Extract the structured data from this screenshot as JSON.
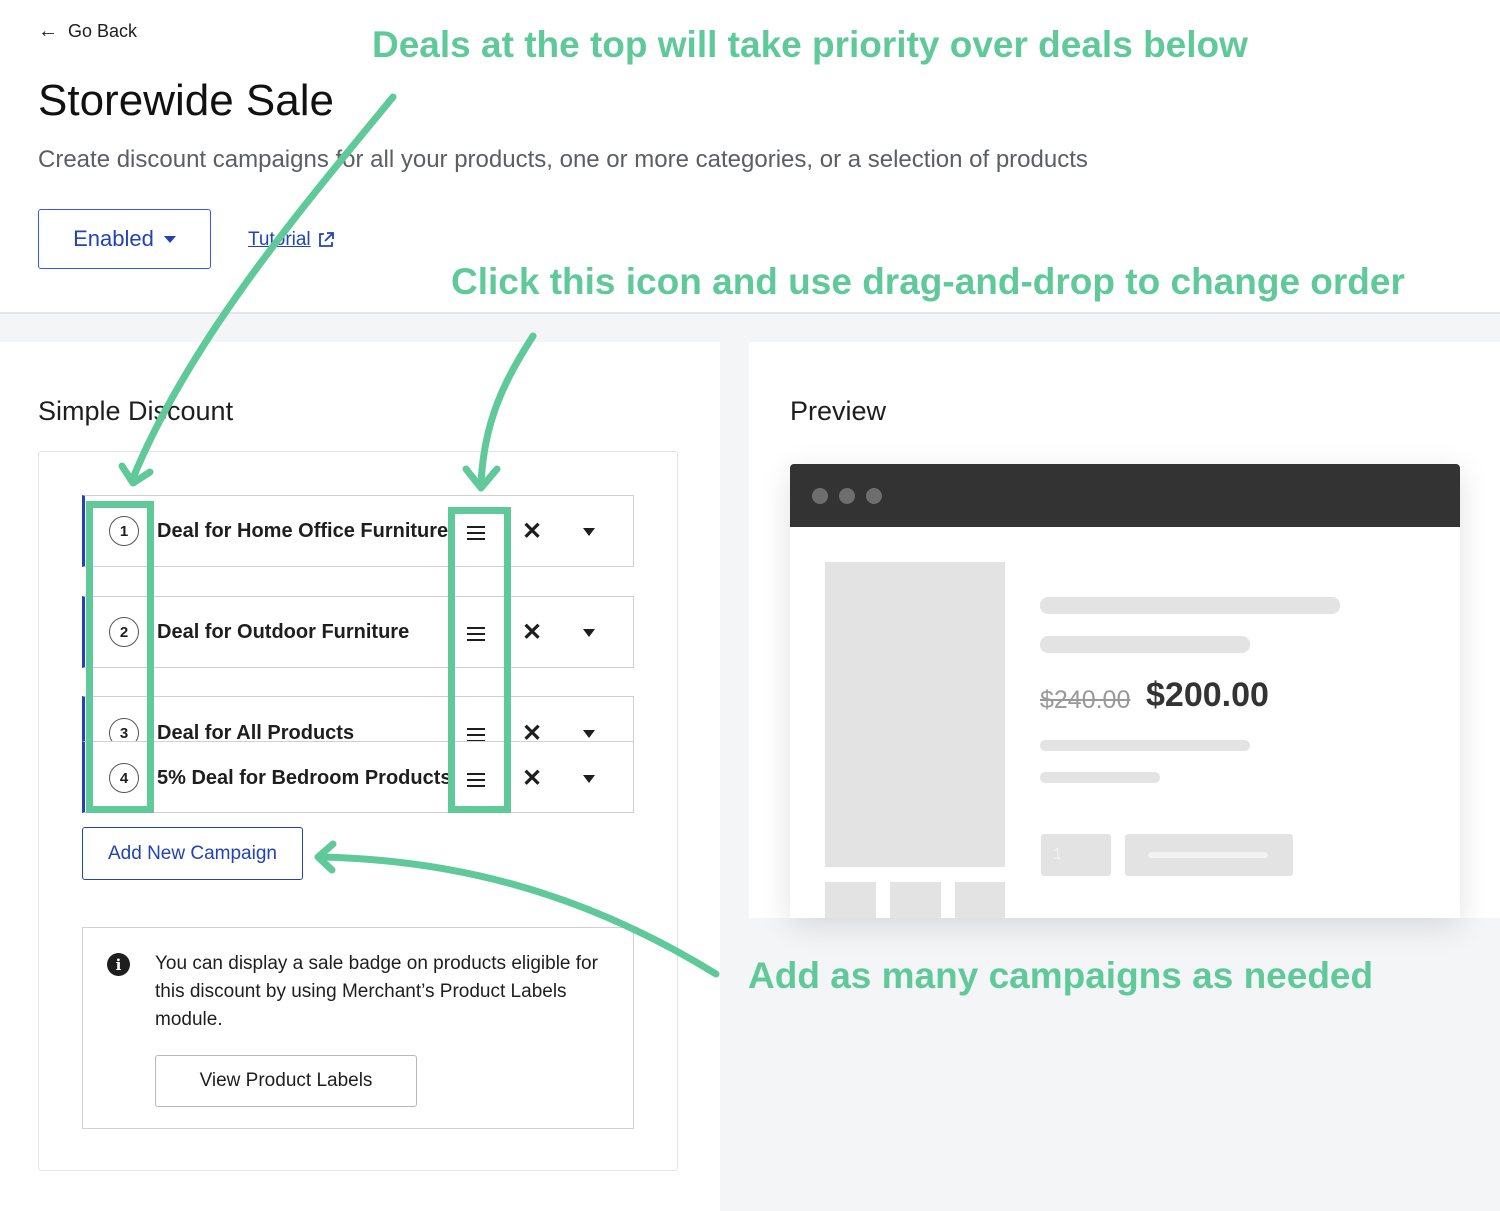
{
  "header": {
    "back_label": "Go Back",
    "title": "Storewide Sale",
    "subtitle": "Create discount campaigns for all your products, one or more categories, or a selection of products",
    "status_label": "Enabled",
    "tutorial_label": "Tutorial"
  },
  "left": {
    "section_title": "Simple Discount",
    "deals": [
      {
        "number": "1",
        "label": "Deal for Home Office Furniture"
      },
      {
        "number": "2",
        "label": "Deal for Outdoor Furniture"
      },
      {
        "number": "3",
        "label": "Deal for All Products"
      },
      {
        "number": "4",
        "label": "5% Deal for Bedroom Products"
      }
    ],
    "add_button": "Add New Campaign",
    "notice_text": "You can display a sale badge on products eligible for this discount by using Merchant’s Product Labels module.",
    "notice_button": "View Product Labels"
  },
  "preview": {
    "title": "Preview",
    "old_price": "$240.00",
    "new_price": "$200.00",
    "quantity": "1"
  },
  "annotations": {
    "priority": "Deals at the top will take priority over deals below",
    "drag": "Click this icon and use drag-and-drop to change order",
    "add": "Add as many campaigns as needed"
  },
  "colors": {
    "accent": "#2243b6",
    "annotation": "#5fc99a",
    "browser_bar": "#333333"
  },
  "icons": [
    "arrow-left-icon",
    "caret-down-icon",
    "external-link-icon",
    "drag-handle-icon",
    "close-icon",
    "chevron-down-icon",
    "info-icon"
  ]
}
